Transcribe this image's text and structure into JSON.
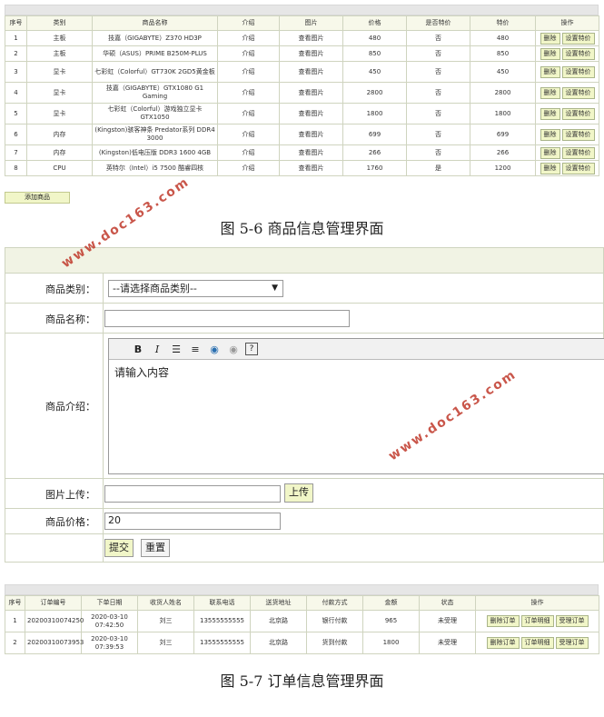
{
  "products": {
    "headers": [
      "序号",
      "类别",
      "商品名称",
      "介绍",
      "图片",
      "价格",
      "是否特价",
      "特价",
      "操作"
    ],
    "rows": [
      {
        "no": "1",
        "cat": "主板",
        "name": "技嘉（GIGABYTE）Z370 HD3P",
        "intro": "介绍",
        "img": "查看图片",
        "price": "480",
        "special": "否",
        "sprice": "480"
      },
      {
        "no": "2",
        "cat": "主板",
        "name": "华硕（ASUS）PRIME B250M-PLUS",
        "intro": "介绍",
        "img": "查看图片",
        "price": "850",
        "special": "否",
        "sprice": "850"
      },
      {
        "no": "3",
        "cat": "显卡",
        "name": "七彩虹（Colorful）GT730K 2GD5黄金板",
        "intro": "介绍",
        "img": "查看图片",
        "price": "450",
        "special": "否",
        "sprice": "450"
      },
      {
        "no": "4",
        "cat": "显卡",
        "name": "技嘉（GIGABYTE）GTX1080 G1 Gaming",
        "intro": "介绍",
        "img": "查看图片",
        "price": "2800",
        "special": "否",
        "sprice": "2800"
      },
      {
        "no": "5",
        "cat": "显卡",
        "name": "七彩虹（Colorful）游戏独立显卡 GTX1050",
        "intro": "介绍",
        "img": "查看图片",
        "price": "1800",
        "special": "否",
        "sprice": "1800"
      },
      {
        "no": "6",
        "cat": "内存",
        "name": "(Kingston)骇客神条 Predator系列 DDR4 3000",
        "intro": "介绍",
        "img": "查看图片",
        "price": "699",
        "special": "否",
        "sprice": "699"
      },
      {
        "no": "7",
        "cat": "内存",
        "name": "(Kingston)低电压版 DDR3 1600 4GB",
        "intro": "介绍",
        "img": "查看图片",
        "price": "266",
        "special": "否",
        "sprice": "266"
      },
      {
        "no": "8",
        "cat": "CPU",
        "name": "英特尔（Intel）i5 7500 酷睿四核",
        "intro": "介绍",
        "img": "查看图片",
        "price": "1760",
        "special": "是",
        "sprice": "1200"
      }
    ],
    "delete_label": "删除",
    "set_special_label": "设置特价",
    "add_label": "添加商品"
  },
  "caption1": "图 5-6 商品信息管理界面",
  "form": {
    "category_label": "商品类别：",
    "category_value": "--请选择商品类别--",
    "name_label": "商品名称：",
    "intro_label": "商品介绍：",
    "editor_placeholder": "请输入内容",
    "image_label": "图片上传：",
    "upload_label": "上传",
    "price_label": "商品价格：",
    "price_value": "20",
    "submit_label": "提交",
    "reset_label": "重置"
  },
  "orders": {
    "headers": [
      "序号",
      "订单编号",
      "下单日期",
      "收货人姓名",
      "联系电话",
      "送货地址",
      "付款方式",
      "金额",
      "状态",
      "操作"
    ],
    "rows": [
      {
        "no": "1",
        "id": "20200310074250",
        "date": "2020-03-10 07:42:50",
        "name": "刘三",
        "phone": "13555555555",
        "addr": "北京路",
        "pay": "银行付款",
        "amount": "965",
        "status": "未受理"
      },
      {
        "no": "2",
        "id": "20200310073953",
        "date": "2020-03-10 07:39:53",
        "name": "刘三",
        "phone": "13555555555",
        "addr": "北京路",
        "pay": "货到付款",
        "amount": "1800",
        "status": "未受理"
      }
    ],
    "delete_label": "删除订单",
    "detail_label": "订单明细",
    "accept_label": "受理订单"
  },
  "caption2": "图 5-7 订单信息管理界面",
  "watermark": "www.doc163.com"
}
